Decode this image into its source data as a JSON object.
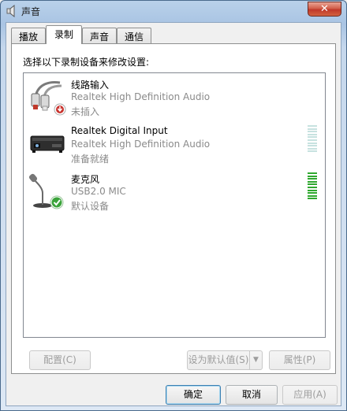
{
  "window": {
    "title": "声音",
    "close_label": "✕"
  },
  "tabs": [
    {
      "label": "播放",
      "active": false
    },
    {
      "label": "录制",
      "active": true
    },
    {
      "label": "声音",
      "active": false
    },
    {
      "label": "通信",
      "active": false
    }
  ],
  "panel": {
    "instruction": "选择以下录制设备来修改设置:"
  },
  "devices": [
    {
      "name": "线路输入",
      "driver": "Realtek High Definition Audio",
      "status": "未插入",
      "icon": "line-in-icon",
      "level": null
    },
    {
      "name": "Realtek Digital Input",
      "driver": "Realtek High Definition Audio",
      "status": "准备就绪",
      "icon": "digital-input-icon",
      "level": 0.0
    },
    {
      "name": "麦克风",
      "driver": "USB2.0 MIC",
      "status": "默认设备",
      "icon": "microphone-icon",
      "level": 1.0
    }
  ],
  "panel_buttons": {
    "configure": "配置(C)",
    "set_default": "设为默认值(S)",
    "properties": "属性(P)"
  },
  "dialog_buttons": {
    "ok": "确定",
    "cancel": "取消",
    "apply": "应用(A)"
  },
  "colors": {
    "meter_active": "#2fa82f",
    "meter_inactive": "#c7e2e0",
    "default_check": "#3aa33a",
    "unplugged_badge": "#c8322d"
  }
}
